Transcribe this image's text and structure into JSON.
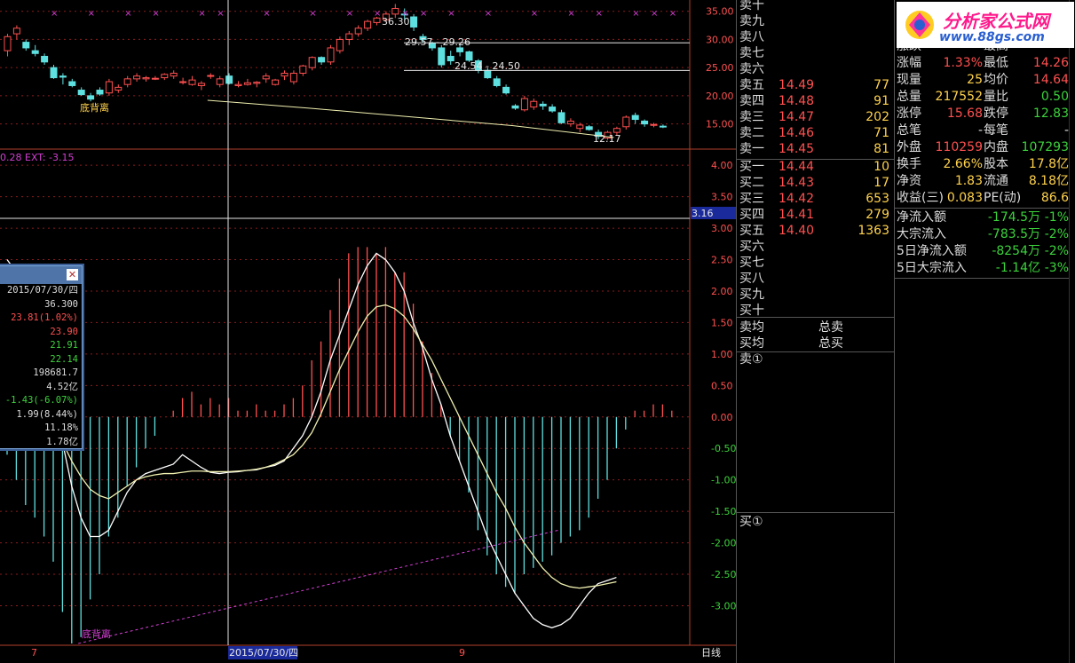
{
  "price_axis": {
    "ticks": [
      "35.00",
      "30.00",
      "25.00",
      "20.00",
      "15.00"
    ]
  },
  "price_annotations": {
    "high": "36.30",
    "band1": "29.57 - 29.26",
    "band2": "24.54 - 24.50",
    "low": "12.17",
    "divergence_label": "底背离"
  },
  "macd_header": "0.28  EXT: -3.15",
  "macd_axis": {
    "ticks": [
      "4.00",
      "3.50",
      "3.00",
      "2.50",
      "2.00",
      "1.50",
      "1.00",
      "0.50",
      "0.00",
      "-0.50",
      "-1.00",
      "-1.50",
      "-2.00",
      "-2.50",
      "-3.00"
    ],
    "current": "3.16"
  },
  "macd_divergence_label": "底背离",
  "time_axis": {
    "left": "7",
    "cursor": "2015/07/30/四",
    "right": "9",
    "period": "日线"
  },
  "info_box": {
    "date": "2015/07/30/四",
    "values": [
      {
        "text": "36.300",
        "color": "#dddddd"
      },
      {
        "text": "23.81(1.02%)",
        "color": "#ff5050"
      },
      {
        "text": "23.90",
        "color": "#ff5050"
      },
      {
        "text": "21.91",
        "color": "#3cd33c"
      },
      {
        "text": "22.14",
        "color": "#3cd33c"
      },
      {
        "text": "198681.7",
        "color": "#dddddd"
      },
      {
        "text": "4.52亿",
        "color": "#dddddd"
      },
      {
        "text": "-1.43(-6.07%)",
        "color": "#3cd33c"
      },
      {
        "text": "1.99(8.44%)",
        "color": "#dddddd"
      },
      {
        "text": "11.18%",
        "color": "#dddddd"
      },
      {
        "text": "1.78亿",
        "color": "#dddddd"
      }
    ]
  },
  "order_book": {
    "sell_levels": [
      {
        "label": "卖十",
        "price": "",
        "vol": ""
      },
      {
        "label": "卖九",
        "price": "",
        "vol": ""
      },
      {
        "label": "卖八",
        "price": "",
        "vol": ""
      },
      {
        "label": "卖七",
        "price": "",
        "vol": ""
      },
      {
        "label": "卖六",
        "price": "",
        "vol": ""
      },
      {
        "label": "卖五",
        "price": "14.49",
        "vol": "77"
      },
      {
        "label": "卖四",
        "price": "14.48",
        "vol": "91"
      },
      {
        "label": "卖三",
        "price": "14.47",
        "vol": "202"
      },
      {
        "label": "卖二",
        "price": "14.46",
        "vol": "71"
      },
      {
        "label": "卖一",
        "price": "14.45",
        "vol": "81"
      }
    ],
    "buy_levels": [
      {
        "label": "买一",
        "price": "14.44",
        "vol": "10"
      },
      {
        "label": "买二",
        "price": "14.43",
        "vol": "17"
      },
      {
        "label": "买三",
        "price": "14.42",
        "vol": "653"
      },
      {
        "label": "买四",
        "price": "14.41",
        "vol": "279"
      },
      {
        "label": "买五",
        "price": "14.40",
        "vol": "1363"
      },
      {
        "label": "买六",
        "price": "",
        "vol": ""
      },
      {
        "label": "买七",
        "price": "",
        "vol": ""
      },
      {
        "label": "买八",
        "price": "",
        "vol": ""
      },
      {
        "label": "买九",
        "price": "",
        "vol": ""
      },
      {
        "label": "买十",
        "price": "",
        "vol": ""
      }
    ],
    "sell_avg": "卖均",
    "total_sell": "总卖",
    "buy_avg": "买均",
    "total_buy": "总买",
    "sell_queue": "卖①",
    "buy_queue": "买①"
  },
  "stats": {
    "rows": [
      {
        "l1": "涨跌",
        "v1": "",
        "c1": "#ff5050",
        "l2": "最高",
        "v2": "",
        "c2": "#ff5050"
      },
      {
        "l1": "涨幅",
        "v1": "1.33%",
        "c1": "#ff5050",
        "l2": "最低",
        "v2": "14.26",
        "c2": "#ff5050"
      },
      {
        "l1": "现量",
        "v1": "25",
        "c1": "#ffd24d",
        "l2": "均价",
        "v2": "14.64",
        "c2": "#ff5050"
      },
      {
        "l1": "总量",
        "v1": "217552",
        "c1": "#ffd24d",
        "l2": "量比",
        "v2": "0.50",
        "c2": "#3cd33c"
      },
      {
        "l1": "涨停",
        "v1": "15.68",
        "c1": "#ff5050",
        "l2": "跌停",
        "v2": "12.83",
        "c2": "#3cd33c"
      },
      {
        "l1": "总笔",
        "v1": "-",
        "c1": "#dddddd",
        "l2": "每笔",
        "v2": "-",
        "c2": "#dddddd"
      },
      {
        "l1": "外盘",
        "v1": "110259",
        "c1": "#ff5050",
        "l2": "内盘",
        "v2": "107293",
        "c2": "#3cd33c"
      },
      {
        "l1": "换手",
        "v1": "2.66%",
        "c1": "#ffd24d",
        "l2": "股本",
        "v2": "17.8亿",
        "c2": "#ffd24d"
      },
      {
        "l1": "净资",
        "v1": "1.83",
        "c1": "#ffd24d",
        "l2": "流通",
        "v2": "8.18亿",
        "c2": "#ffd24d"
      },
      {
        "l1": "收益(三)",
        "v1": "0.083",
        "c1": "#ffd24d",
        "l2": "PE(动)",
        "v2": "86.6",
        "c2": "#ffd24d"
      }
    ],
    "flows": [
      {
        "label": "净流入额",
        "value": "-174.5万",
        "pct": "-1%"
      },
      {
        "label": "大宗流入",
        "value": "-783.5万",
        "pct": "-2%"
      },
      {
        "label": "5日净流入额",
        "value": "-8254万",
        "pct": "-2%"
      },
      {
        "label": "5日大宗流入",
        "value": "-1.14亿",
        "pct": "-3%"
      }
    ]
  },
  "logo": {
    "title": "分析家公式网",
    "url": "www.88gs.com"
  },
  "colors": {
    "up": "#ff5050",
    "down": "#5fe0e0",
    "ma_line": "#f0f0b0",
    "divergence": "#d23fd2",
    "grid": "#8a1d1d",
    "axis": "#b0402b"
  },
  "chart_data": [
    {
      "type": "candlestick",
      "title": "",
      "ylim": [
        11,
        37
      ],
      "candles": [
        [
          28,
          31,
          27,
          30.5
        ],
        [
          31,
          32.5,
          30,
          32
        ],
        [
          29.5,
          30,
          28,
          28.5
        ],
        [
          28,
          29,
          27,
          27.5
        ],
        [
          27,
          27.5,
          25.5,
          26
        ],
        [
          25,
          25.5,
          23,
          23.2
        ],
        [
          23.5,
          24,
          22,
          23.3
        ],
        [
          22.5,
          23,
          21.5,
          21.8
        ],
        [
          21,
          21.5,
          20,
          20.2
        ],
        [
          20,
          20.5,
          19,
          19.4
        ],
        [
          21,
          21.5,
          20,
          20.3
        ],
        [
          20.5,
          23,
          20,
          22.5
        ],
        [
          21,
          22,
          20.5,
          21.5
        ],
        [
          22,
          23.5,
          21.5,
          23
        ],
        [
          23,
          24,
          22.5,
          23.5
        ],
        [
          23,
          23.5,
          22.5,
          23.2
        ],
        [
          23,
          23.5,
          22.8,
          23.1
        ],
        [
          23.2,
          24,
          22.8,
          23.8
        ],
        [
          23.5,
          24.5,
          23,
          24
        ],
        [
          22.5,
          23.2,
          22,
          22.5
        ],
        [
          22,
          23.5,
          21.8,
          22.8
        ],
        [
          21.8,
          22.6,
          21,
          22.2
        ],
        [
          23.5,
          24,
          23,
          23.6
        ],
        [
          22,
          23.5,
          21.5,
          23.0
        ],
        [
          23.5,
          24,
          22,
          22.2
        ],
        [
          21.8,
          22.6,
          21.5,
          22
        ],
        [
          22,
          23,
          21.8,
          22.3
        ],
        [
          22.2,
          22.6,
          21.5,
          22.4
        ],
        [
          23,
          24,
          22.3,
          23.5
        ],
        [
          22,
          23,
          21.8,
          22.8
        ],
        [
          23.5,
          24.5,
          22.8,
          24
        ],
        [
          22.5,
          24.5,
          22,
          24
        ],
        [
          24,
          25.5,
          23.5,
          25.3
        ],
        [
          25,
          27,
          24.5,
          26.8
        ],
        [
          26.8,
          27,
          25.5,
          26
        ],
        [
          26,
          29,
          25.5,
          28.5
        ],
        [
          28,
          30.5,
          27.5,
          30
        ],
        [
          30,
          31.5,
          29,
          31
        ],
        [
          31,
          32.5,
          30.5,
          32
        ],
        [
          32,
          33.5,
          31.5,
          33.2
        ],
        [
          33,
          34,
          32.5,
          33.8
        ],
        [
          33.5,
          35,
          33,
          34.5
        ],
        [
          34.5,
          36.3,
          33.8,
          35.5
        ],
        [
          34.5,
          35.5,
          33.5,
          34.4
        ],
        [
          34,
          34.5,
          31.5,
          32.2
        ],
        [
          30.5,
          31,
          29.5,
          30.0
        ],
        [
          29.3,
          29.6,
          28,
          28.5
        ],
        [
          28.5,
          29,
          25,
          25.5
        ],
        [
          27,
          28,
          25.5,
          26.2
        ],
        [
          28.5,
          29,
          27,
          27.8
        ],
        [
          27.8,
          28,
          26,
          26.3
        ],
        [
          26.2,
          26.5,
          24,
          24.5
        ],
        [
          24.5,
          25,
          23,
          23.2
        ],
        [
          23,
          23.5,
          21.5,
          21.8
        ],
        [
          21.5,
          22,
          20.2,
          20.5
        ],
        [
          18.2,
          18.5,
          17.5,
          17.8
        ],
        [
          17.5,
          20,
          17.2,
          19.5
        ],
        [
          18,
          19.5,
          17.5,
          19
        ],
        [
          18.5,
          19,
          17.5,
          18.2
        ],
        [
          18,
          18.5,
          17,
          17.3
        ],
        [
          17,
          17.5,
          15,
          15.2
        ],
        [
          15,
          16,
          14.5,
          15.5
        ],
        [
          14.2,
          15.2,
          13.5,
          14.8
        ],
        [
          14.5,
          14.8,
          13.8,
          14.0
        ],
        [
          13.5,
          14,
          12.3,
          12.8
        ],
        [
          12.5,
          13.8,
          12.17,
          13.5
        ],
        [
          13.5,
          14.5,
          13,
          14.2
        ],
        [
          14.5,
          16.5,
          14,
          16.2
        ],
        [
          16.5,
          17,
          15,
          15.8
        ],
        [
          15.5,
          15.8,
          14.5,
          15.0
        ],
        [
          14.8,
          15.2,
          14.4,
          14.9
        ],
        [
          14.6,
          14.9,
          14.26,
          14.5
        ]
      ],
      "support_line": [
        [
          19.2,
          22
        ],
        [
          17.8,
          33
        ],
        [
          14.7,
          55
        ],
        [
          12.6,
          66
        ]
      ],
      "resistance_levels": [
        29.4,
        24.5
      ]
    },
    {
      "type": "bar",
      "title": "",
      "ylim": [
        -3.6,
        4.2
      ],
      "macd": [
        -0.6,
        -1.0,
        -1.4,
        -1.6,
        -1.9,
        -2.3,
        -3.1,
        -3.6,
        -3.5,
        -2.9,
        -2.5,
        -1.9,
        -1.6,
        -1.1,
        -0.8,
        -0.5,
        -0.3,
        0,
        0.1,
        0.3,
        0.4,
        0.2,
        0.3,
        0.2,
        0.3,
        0.1,
        0.1,
        0.2,
        0.1,
        0.1,
        0.2,
        0.3,
        0.5,
        0.9,
        1.2,
        1.7,
        2.2,
        2.6,
        2.7,
        2.7,
        2.6,
        2.7,
        2.3,
        2.3,
        1.8,
        1.2,
        0.7,
        0.2,
        -0.3,
        -0.7,
        -1.2,
        -1.8,
        -2.2,
        -2.5,
        -2.7,
        -2.8,
        -2.5,
        -2.4,
        -2.3,
        -2.2,
        -2.0,
        -1.9,
        -1.8,
        -1.6,
        -1.3,
        -1.0,
        -0.5,
        -0.2,
        0.1,
        0.1,
        0.2,
        0.2,
        0.1
      ],
      "dif": [
        2.5,
        2.3,
        1.9,
        1.4,
        0.8,
        0.3,
        -0.4,
        -1.1,
        -1.6,
        -1.9,
        -1.9,
        -1.8,
        -1.5,
        -1.2,
        -1.0,
        -0.9,
        -0.85,
        -0.8,
        -0.75,
        -0.6,
        -0.7,
        -0.8,
        -0.88,
        -0.9,
        -0.88,
        -0.87,
        -0.85,
        -0.84,
        -0.8,
        -0.77,
        -0.7,
        -0.5,
        -0.3,
        0.0,
        0.4,
        0.9,
        1.3,
        1.7,
        2.1,
        2.4,
        2.6,
        2.5,
        2.3,
        2.0,
        1.5,
        1.1,
        0.6,
        0.2,
        -0.3,
        -0.7,
        -1.1,
        -1.5,
        -1.9,
        -2.2,
        -2.5,
        -2.8,
        -3.0,
        -3.2,
        -3.3,
        -3.35,
        -3.3,
        -3.2,
        -3.0,
        -2.8,
        -2.65,
        -2.6,
        -2.55
      ],
      "dea": [
        1.1,
        1.0,
        0.8,
        0.5,
        0.2,
        -0.1,
        -0.4,
        -0.7,
        -0.95,
        -1.15,
        -1.25,
        -1.3,
        -1.2,
        -1.1,
        -1.0,
        -0.95,
        -0.92,
        -0.9,
        -0.9,
        -0.88,
        -0.86,
        -0.86,
        -0.87,
        -0.87,
        -0.87,
        -0.86,
        -0.85,
        -0.83,
        -0.8,
        -0.75,
        -0.68,
        -0.6,
        -0.45,
        -0.25,
        0.05,
        0.4,
        0.75,
        1.05,
        1.35,
        1.6,
        1.75,
        1.78,
        1.72,
        1.6,
        1.4,
        1.15,
        0.9,
        0.6,
        0.3,
        0.0,
        -0.3,
        -0.6,
        -0.9,
        -1.2,
        -1.45,
        -1.75,
        -2.0,
        -2.2,
        -2.4,
        -2.55,
        -2.65,
        -2.7,
        -2.72,
        -2.7,
        -2.68,
        -2.65,
        -2.62
      ],
      "divergence_line": [
        [
          -3.6,
          8
        ],
        [
          -1.8,
          60
        ]
      ]
    }
  ]
}
